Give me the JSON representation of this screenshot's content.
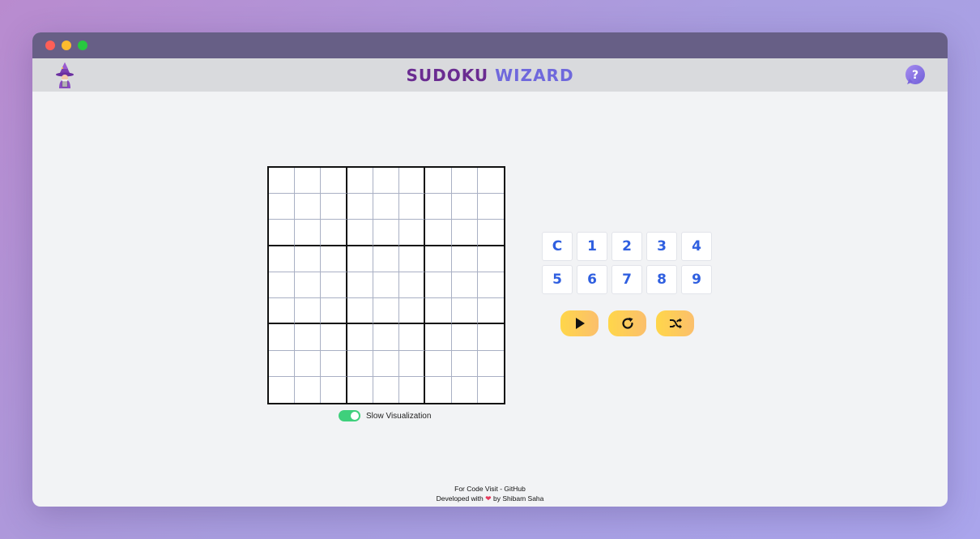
{
  "window": {
    "controls": [
      "close",
      "minimize",
      "maximize"
    ]
  },
  "header": {
    "title_part1": "SUDOKU",
    "title_part2": "WIZARD",
    "logo_icon": "wizard-icon",
    "help_icon": "help-bubble-icon",
    "title_colors": {
      "part1": "#6a2c91",
      "part2": "#6f68dc"
    }
  },
  "board": {
    "size": 9,
    "cells": [
      [
        "",
        "",
        "",
        "",
        "",
        "",
        "",
        "",
        ""
      ],
      [
        "",
        "",
        "",
        "",
        "",
        "",
        "",
        "",
        ""
      ],
      [
        "",
        "",
        "",
        "",
        "",
        "",
        "",
        "",
        ""
      ],
      [
        "",
        "",
        "",
        "",
        "",
        "",
        "",
        "",
        ""
      ],
      [
        "",
        "",
        "",
        "",
        "",
        "",
        "",
        "",
        ""
      ],
      [
        "",
        "",
        "",
        "",
        "",
        "",
        "",
        "",
        ""
      ],
      [
        "",
        "",
        "",
        "",
        "",
        "",
        "",
        "",
        ""
      ],
      [
        "",
        "",
        "",
        "",
        "",
        "",
        "",
        "",
        ""
      ],
      [
        "",
        "",
        "",
        "",
        "",
        "",
        "",
        "",
        ""
      ]
    ]
  },
  "toggle": {
    "label": "Slow Visualization",
    "checked": true,
    "color": "#3fd07c"
  },
  "numpad": {
    "keys": [
      "C",
      "1",
      "2",
      "3",
      "4",
      "5",
      "6",
      "7",
      "8",
      "9"
    ],
    "key_color": "#2f5fe0"
  },
  "actions": [
    {
      "name": "play",
      "icon": "play-icon"
    },
    {
      "name": "reset",
      "icon": "refresh-icon"
    },
    {
      "name": "shuffle",
      "icon": "shuffle-icon"
    }
  ],
  "footer": {
    "line1": "For Code Visit - GitHub",
    "line2_prefix": "Developed with",
    "line2_suffix": "by Shibam Saha",
    "heart_icon": "heart-icon"
  }
}
